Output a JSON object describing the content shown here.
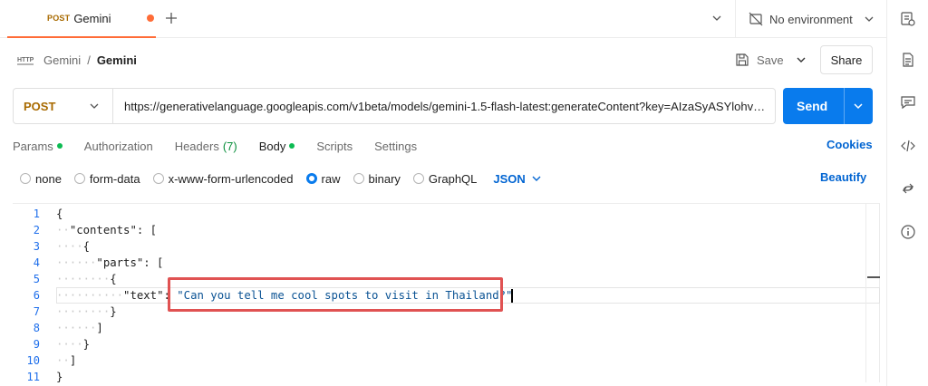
{
  "tab": {
    "method": "POST",
    "name": "Gemini"
  },
  "environment": {
    "label": "No environment"
  },
  "breadcrumb": {
    "parent": "Gemini",
    "separator": "/",
    "current": "Gemini",
    "icon_text": "HTTP"
  },
  "actions": {
    "save_label": "Save",
    "share_label": "Share"
  },
  "request": {
    "method": "POST",
    "url": "https://generativelanguage.googleapis.com/v1beta/models/gemini-1.5-flash-latest:generateContent?key=AIzaSyASYlohvuvf:...",
    "send_label": "Send"
  },
  "request_tabs": [
    {
      "label": "Params",
      "dot": true
    },
    {
      "label": "Authorization"
    },
    {
      "label": "Headers",
      "count": "(7)"
    },
    {
      "label": "Body",
      "dot": true,
      "active": true
    },
    {
      "label": "Scripts"
    },
    {
      "label": "Settings"
    }
  ],
  "cookies_label": "Cookies",
  "body_types": [
    {
      "label": "none"
    },
    {
      "label": "form-data"
    },
    {
      "label": "x-www-form-urlencoded"
    },
    {
      "label": "raw",
      "selected": true
    },
    {
      "label": "binary"
    },
    {
      "label": "GraphQL"
    }
  ],
  "body_language": "JSON",
  "beautify_label": "Beautify",
  "editor": {
    "line_numbers": [
      "1",
      "2",
      "3",
      "4",
      "5",
      "6",
      "7",
      "8",
      "9",
      "10",
      "11"
    ],
    "lines": {
      "l1": "{",
      "l2_key": "\"contents\"",
      "l2_rest": ": [",
      "l3": "{",
      "l4_key": "\"parts\"",
      "l4_rest": ": [",
      "l5": "{",
      "l6_key": "\"text\"",
      "l6_colon": ": ",
      "l6_value": "\"Can you tell me cool spots to visit in Thailand?\"",
      "l7": "}",
      "l8": "]",
      "l9": "}",
      "l10": "]",
      "l11": "}"
    }
  },
  "colors": {
    "accent_orange": "#ff6c37",
    "send_blue": "#097bed",
    "link_blue": "#0265d2",
    "highlight_red": "#e05252"
  },
  "icons": [
    "plus-icon",
    "chevron-down-icon",
    "no-environment-icon",
    "http-icon",
    "save-icon",
    "documentation-icon",
    "comments-icon",
    "code-icon",
    "related-icon",
    "info-icon",
    "environment-quick-look-icon"
  ]
}
